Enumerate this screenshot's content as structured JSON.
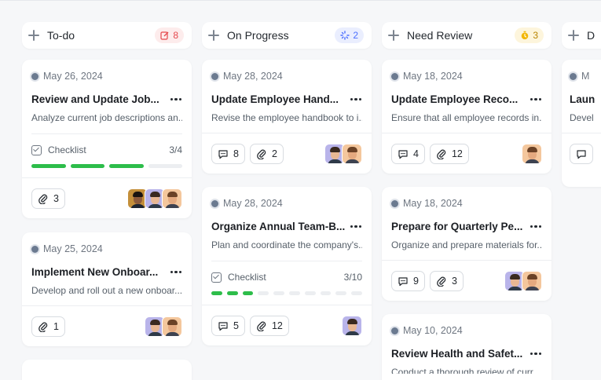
{
  "columns": [
    {
      "title": "To-do",
      "count": "8",
      "badge_icon": "edit-note-icon",
      "badge_color": "#e5484d",
      "badge_bg": "#fdecec",
      "cards": [
        {
          "date": "May 26, 2024",
          "title": "Review and Update Job...",
          "desc": "Analyze current job descriptions an...",
          "checklist_label": "Checklist",
          "checklist_count": "3/4",
          "checklist_done": 3,
          "checklist_total": 4,
          "attachments": "3"
        },
        {
          "date": "May 25, 2024",
          "title": "Implement New Onboar...",
          "desc": "Develop and roll out a new onboar...",
          "attachments": "1"
        }
      ]
    },
    {
      "title": "On Progress",
      "count": "2",
      "badge_icon": "spinner-icon",
      "badge_color": "#4c6fff",
      "badge_bg": "#eaeefe",
      "cards": [
        {
          "date": "May 28, 2024",
          "title": "Update Employee Hand...",
          "desc": "Revise the employee handbook to i...",
          "comments": "8",
          "attachments": "2"
        },
        {
          "date": "May 28, 2024",
          "title": "Organize Annual Team-B...",
          "desc": "Plan and coordinate the company's...",
          "checklist_label": "Checklist",
          "checklist_count": "3/10",
          "checklist_done": 3,
          "checklist_total": 10,
          "comments": "5",
          "attachments": "12"
        }
      ]
    },
    {
      "title": "Need Review",
      "count": "3",
      "badge_icon": "timer-icon",
      "badge_color": "#e0a100",
      "badge_bg": "#fdf5dc",
      "cards": [
        {
          "date": "May 18, 2024",
          "title": "Update Employee Reco...",
          "desc": "Ensure that all employee records in...",
          "comments": "4",
          "attachments": "12"
        },
        {
          "date": "May 18, 2024",
          "title": "Prepare for Quarterly Pe...",
          "desc": "Organize and prepare materials for...",
          "comments": "9",
          "attachments": "3"
        },
        {
          "date": "May 10, 2024",
          "title": "Review Health and Safet...",
          "desc": "Conduct a thorough review of curr..."
        }
      ]
    },
    {
      "title": "D",
      "cards": [
        {
          "date": "M",
          "title": "Laun",
          "desc": "Devel"
        }
      ]
    }
  ]
}
